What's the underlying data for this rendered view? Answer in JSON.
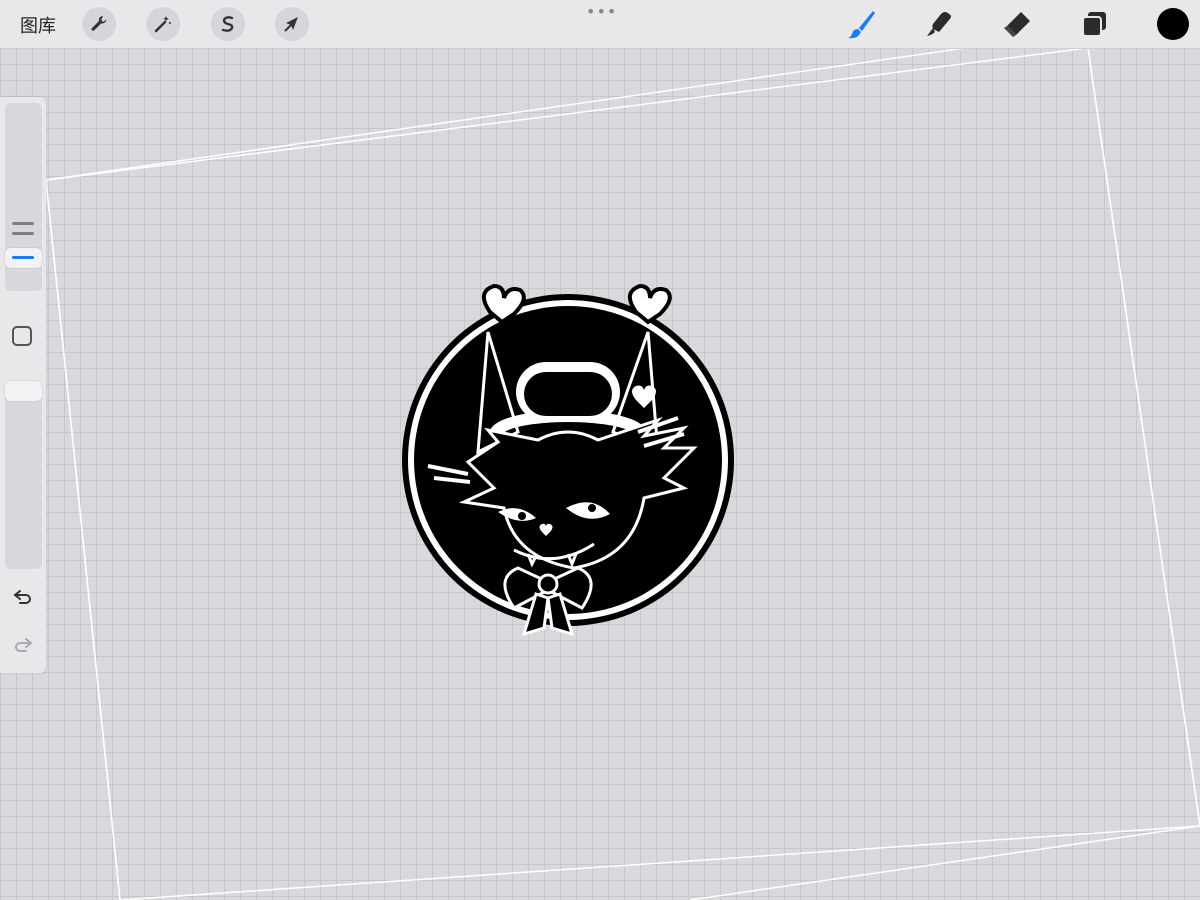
{
  "toolbar": {
    "gallery_label": "图库",
    "left_tools": [
      {
        "name": "actions",
        "icon": "wrench-icon"
      },
      {
        "name": "adjustments",
        "icon": "magic-wand-icon"
      },
      {
        "name": "selection",
        "icon": "selection-s-icon"
      },
      {
        "name": "transform",
        "icon": "arrow-cursor-icon"
      }
    ],
    "more_dots": "•••",
    "right_tools": [
      {
        "name": "brush",
        "icon": "brush-icon",
        "active": true
      },
      {
        "name": "smudge",
        "icon": "smudge-icon",
        "active": false
      },
      {
        "name": "eraser",
        "icon": "eraser-icon",
        "active": false
      },
      {
        "name": "layers",
        "icon": "layers-icon",
        "active": false
      }
    ],
    "current_color": "#000000"
  },
  "sidebar": {
    "brush_size_icon": "size-slider-icon",
    "modify_icon": "square-modify-icon",
    "opacity_icon": "opacity-slider-icon",
    "undo_icon": "undo-icon",
    "redo_icon": "redo-icon"
  },
  "colors": {
    "accent": "#1a7cf5",
    "toolbar_bg": "#e8e8ea",
    "canvas_bg": "#d8d9dc"
  }
}
